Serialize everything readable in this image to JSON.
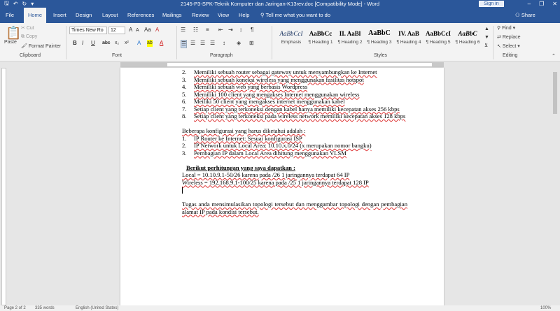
{
  "titlebar": {
    "title": "2145-P3-SPK-Teknik Komputer dan Jaringan-K13rev.doc [Compatibility Mode]  -  Word",
    "signin": "Sign in",
    "minimize": "–",
    "restore": "❐",
    "close": "✕",
    "qat_save": "🖫",
    "qat_undo": "↶",
    "qat_redo": "↻",
    "qat_more": "▾"
  },
  "tabs": {
    "file": "File",
    "home": "Home",
    "insert": "Insert",
    "design": "Design",
    "layout": "Layout",
    "references": "References",
    "mailings": "Mailings",
    "review": "Review",
    "view": "View",
    "help": "Help",
    "tellme": "Tell me what you want to do",
    "share": "Share"
  },
  "ribbon": {
    "clipboard": {
      "paste": "Paste",
      "cut": "Cut",
      "copy": "Copy",
      "format_painter": "Format Painter",
      "label": "Clipboard"
    },
    "font": {
      "font_name": "Times New Ro",
      "font_size": "12",
      "label": "Font",
      "bold": "B",
      "italic": "I",
      "underline": "U",
      "strike": "abc",
      "subscript": "x₂",
      "superscript": "x²",
      "grow": "A",
      "shrink": "A",
      "case": "Aa",
      "clear": "A",
      "effects": "A",
      "highlight": "ab",
      "color": "A"
    },
    "paragraph": {
      "label": "Paragraph"
    },
    "styles": {
      "label": "Styles",
      "items": [
        {
          "sample": "AaBbCcI",
          "name": "Emphasis"
        },
        {
          "sample": "AaBbCc",
          "name": "¶ Heading 1"
        },
        {
          "sample": "II. AaBl",
          "name": "¶ Heading 2"
        },
        {
          "sample": "AaBbC",
          "name": "¶ Heading 3"
        },
        {
          "sample": "IV. AaB",
          "name": "¶ Heading 4"
        },
        {
          "sample": "AaBbCcI",
          "name": "¶ Heading 5"
        },
        {
          "sample": "AaBbC",
          "name": "¶ Heading 6"
        }
      ]
    },
    "editing": {
      "find": "Find",
      "replace": "Replace",
      "select": "Select",
      "label": "Editing"
    }
  },
  "document": {
    "list1": [
      {
        "n": "2.",
        "text": "Memiliki sebuah router sebagai gateway untuk menyambungkan ke Internet"
      },
      {
        "n": "3.",
        "text": "Memiliki sebuah koneksi wireless yang menggunakan fasilitas hotspot"
      },
      {
        "n": "4.",
        "text": "Memiliki sebuah web yang berbasis Wordpress"
      },
      {
        "n": "5.",
        "text": "Memiliki 100 client yang mengakses Internet menggunakan wireless"
      },
      {
        "n": "6.",
        "text": "Meiliki 50 client yang mengakses internet menggunakan kabel"
      },
      {
        "n": "7.",
        "text": "Setiap client yang terkoneksi dengan kabel hanya memiliki kecepatan akses 256 kbps"
      },
      {
        "n": "8.",
        "text": "Setiap client yang terkoneksi pada wireless network memiliki kecepatan akses 128 kbps"
      }
    ],
    "config_intro": "Beberapa konfigurasi yang harus diketahui adalah :",
    "list2": [
      {
        "n": "1.",
        "text": "IP Router ke Internet: Sesuai konfigurasi ISP"
      },
      {
        "n": "2.",
        "text": "IP Network untuk Local Area: 10.10.x.0/24 (x merupakan nomor bangku)"
      },
      {
        "n": "3.",
        "text": "Pembagian IP dalam Local Area dihitung menggunakan VLSM"
      }
    ],
    "calc_heading": "Berikut perhitungan yang saya dapatkan :",
    "local_line": "Local = 10.10.9.1-50/26 karena pada /26 1 jaringannya terdapat 64 IP",
    "wireless_line": "Wireless = 192.168.9.1-100/25 karena pada /25 1 jaringannya terdapat 128 IP",
    "task": "Tugas anda mensimulasikan topologi tersebut dan menggambar topologi dengan pembagian alamat IP pada kondisi tersebut."
  },
  "status": {
    "page": "Page 2 of 2",
    "words": "335 words",
    "language": "English (United States)",
    "zoom": "100%"
  }
}
